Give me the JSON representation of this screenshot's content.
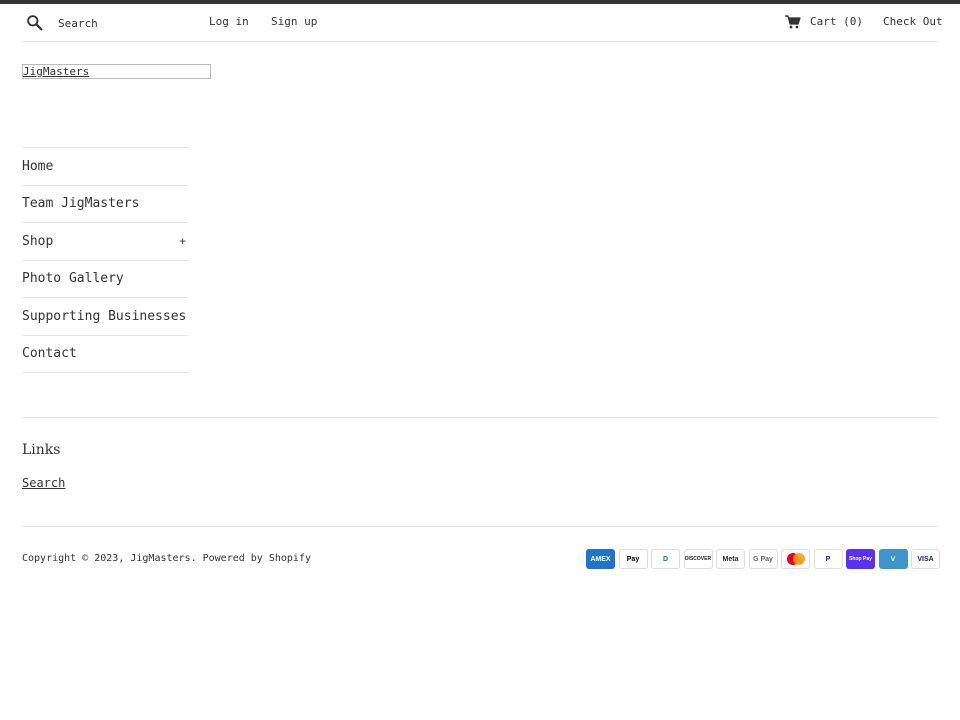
{
  "header": {
    "search_placeholder": "Search",
    "login_label": "Log in",
    "signup_label": "Sign up",
    "cart_label": "Cart (0)",
    "checkout_label": "Check Out"
  },
  "logo": {
    "text": "JigMasters"
  },
  "nav": {
    "items": [
      {
        "label": "Home"
      },
      {
        "label": "Team JigMasters"
      },
      {
        "label": "Shop",
        "expander": "+"
      },
      {
        "label": "Photo Gallery"
      },
      {
        "label": "Supporting Businesses"
      },
      {
        "label": "Contact"
      }
    ]
  },
  "footer": {
    "links_title": "Links",
    "links": [
      {
        "label": "Search"
      }
    ],
    "copyright": "Copyright © 2023, JigMasters. Powered by Shopify"
  },
  "payment_icons": [
    {
      "name": "amex-icon",
      "label": "AMEX",
      "bg": "#1f72cd",
      "fg": "#ffffff"
    },
    {
      "name": "apple-pay-icon",
      "label": "Pay",
      "bg": "#ffffff",
      "fg": "#000000"
    },
    {
      "name": "diners-club-icon",
      "label": "D",
      "bg": "#ffffff",
      "fg": "#0079be"
    },
    {
      "name": "discover-icon",
      "label": "DISCOVER",
      "bg": "#ffffff",
      "fg": "#222222"
    },
    {
      "name": "meta-pay-icon",
      "label": "Meta",
      "bg": "#ffffff",
      "fg": "#1c2b33"
    },
    {
      "name": "google-pay-icon",
      "label": "G Pay",
      "bg": "#ffffff",
      "fg": "#5f6368"
    },
    {
      "name": "mastercard-icon",
      "label": "",
      "bg": "#ffffff",
      "fg": "#eb001b"
    },
    {
      "name": "paypal-icon",
      "label": "P",
      "bg": "#ffffff",
      "fg": "#003087"
    },
    {
      "name": "shop-pay-icon",
      "label": "Shop Pay",
      "bg": "#5a31f4",
      "fg": "#ffffff"
    },
    {
      "name": "venmo-icon",
      "label": "V",
      "bg": "#3d95ce",
      "fg": "#ffffff"
    },
    {
      "name": "visa-icon",
      "label": "VISA",
      "bg": "#ffffff",
      "fg": "#142688"
    }
  ]
}
